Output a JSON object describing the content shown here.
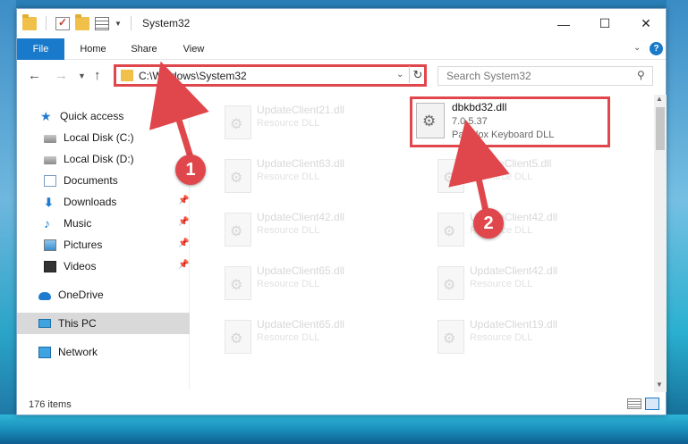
{
  "window": {
    "title": "System32",
    "controls": {
      "minimize": "—",
      "maximize": "☐",
      "close": "✕"
    }
  },
  "ribbon": {
    "tabs": [
      {
        "label": "File",
        "active": true
      },
      {
        "label": "Home"
      },
      {
        "label": "Share"
      },
      {
        "label": "View"
      }
    ],
    "expand_icon": "chevron-down-icon",
    "help_icon": "?"
  },
  "navigation": {
    "back": "←",
    "forward": "→",
    "recent": "⌄",
    "up": "↑",
    "address": "C:\\Windows\\System32",
    "refresh": "↻",
    "search_placeholder": "Search System32"
  },
  "sidebar": {
    "items": [
      {
        "label": "Quick access",
        "icon": "star-icon"
      },
      {
        "label": "Local Disk (C:)",
        "icon": "disk-icon"
      },
      {
        "label": "Local Disk (D:)",
        "icon": "disk-icon"
      },
      {
        "label": "Documents",
        "icon": "document-icon"
      },
      {
        "label": "Downloads",
        "icon": "download-icon"
      },
      {
        "label": "Music",
        "icon": "music-icon"
      },
      {
        "label": "Pictures",
        "icon": "pictures-icon"
      },
      {
        "label": "Videos",
        "icon": "videos-icon"
      },
      {
        "label": "OneDrive",
        "icon": "onedrive-icon"
      },
      {
        "label": "This PC",
        "icon": "this-pc-icon",
        "selected": true
      },
      {
        "label": "Network",
        "icon": "network-icon"
      }
    ]
  },
  "files": [
    {
      "name": "UpdateClient21.dll",
      "desc": "Resource DLL"
    },
    {
      "name": "UpdateClient63.dll",
      "desc": "Resource DLL"
    },
    {
      "name": "UpdateClient5.dll",
      "desc": "Resource DLL"
    },
    {
      "name": "UpdateClient42.dll",
      "desc": "Resource DLL"
    },
    {
      "name": "UpdateClient42.dll",
      "desc": "Resource DLL"
    },
    {
      "name": "UpdateClient65.dll",
      "desc": "Resource DLL"
    },
    {
      "name": "UpdateClient42.dll",
      "desc": "Resource DLL"
    },
    {
      "name": "UpdateClient65.dll",
      "desc": "Resource DLL"
    },
    {
      "name": "UpdateClient19.dll",
      "desc": "Resource DLL"
    }
  ],
  "highlighted_file": {
    "name": "dbkbd32.dll",
    "version": "7.0.5.37",
    "desc": "Paradox Keyboard DLL"
  },
  "status": {
    "count": "176 items"
  },
  "annotations": [
    {
      "label": "1"
    },
    {
      "label": "2"
    }
  ],
  "colors": {
    "accent": "#1979ca",
    "highlight": "#e0474c",
    "selected": "#d9d9d9"
  }
}
